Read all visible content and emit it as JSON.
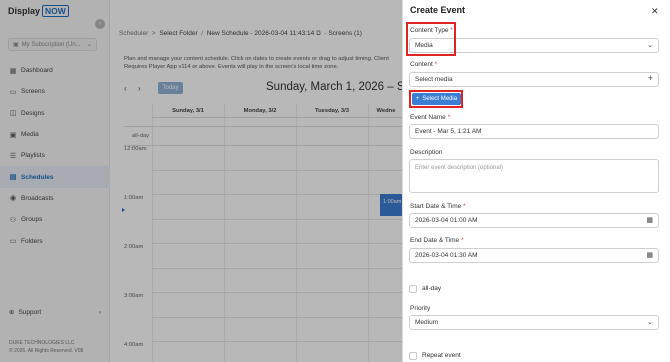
{
  "app": {
    "logo_text": "Display",
    "logo_badge": "NOW",
    "collapse_icon": "‹",
    "subscription_placeholder": "My Subscription (Un...",
    "company": "DUKE TECHNOLOGIES LLC",
    "copyright": "© 2026. All Rights Reserved. V08"
  },
  "sidebar": {
    "items": [
      {
        "label": "Dashboard",
        "icon": "dashboard-icon",
        "glyph": "▦"
      },
      {
        "label": "Screens",
        "icon": "screens-icon",
        "glyph": "▭"
      },
      {
        "label": "Designs",
        "icon": "designs-icon",
        "glyph": "◫"
      },
      {
        "label": "Media",
        "icon": "media-icon",
        "glyph": "▣"
      },
      {
        "label": "Playlists",
        "icon": "playlists-icon",
        "glyph": "☰"
      },
      {
        "label": "Schedules",
        "icon": "schedules-icon",
        "glyph": "▤",
        "active": true
      },
      {
        "label": "Broadcasts",
        "icon": "broadcasts-icon",
        "glyph": "◉"
      },
      {
        "label": "Groups",
        "icon": "groups-icon",
        "glyph": "⚇"
      },
      {
        "label": "Folders",
        "icon": "folders-icon",
        "glyph": "▭"
      }
    ],
    "support_label": "Support"
  },
  "breadcrumb": {
    "scheduler": "Scheduler",
    "sep1": ">",
    "select_folder": "Select Folder",
    "sep2": "/",
    "event": "New Schedule - 2026-03-04 11:43:14",
    "screens": "Screens (1)"
  },
  "description": "Plan and manage your content schedule. Click on dates to create events or drag to adjust timing. Client Requires Player App v114 or above. Events will play in the screen's local time zone.",
  "calendar": {
    "today_label": "Today",
    "title": "Sunday, March 1, 2026 – Sa",
    "days": [
      "Sunday, 3/1",
      "Monday, 3/2",
      "Tuesday, 3/3",
      "Wedne"
    ],
    "allday_label": "all-day",
    "hours": [
      "12:00am",
      "1:00am",
      "2:00am",
      "3:00am",
      "4:00am"
    ],
    "event_label": "1:00am –"
  },
  "panel": {
    "title": "Create Event",
    "content_type_label": "Content Type",
    "content_type_value": "Media",
    "content_label": "Content",
    "content_value": "Select media",
    "select_media_button": "Select Media",
    "event_name_label": "Event Name",
    "event_name_value": "Event - Mar 5, 1:21 AM",
    "description_label": "Description",
    "description_placeholder": "Enter event description (optional)",
    "start_label": "Start Date & Time",
    "start_value": "2026-03-04 01:00 AM",
    "end_label": "End Date & Time",
    "end_value": "2026-03-04 01:30 AM",
    "allday_label": "all-day",
    "priority_label": "Priority",
    "priority_value": "Medium",
    "repeat_label": "Repeat event"
  },
  "colors": {
    "accent": "#1e6fc2",
    "button": "#3b7ed3",
    "highlight": "#e02424"
  }
}
